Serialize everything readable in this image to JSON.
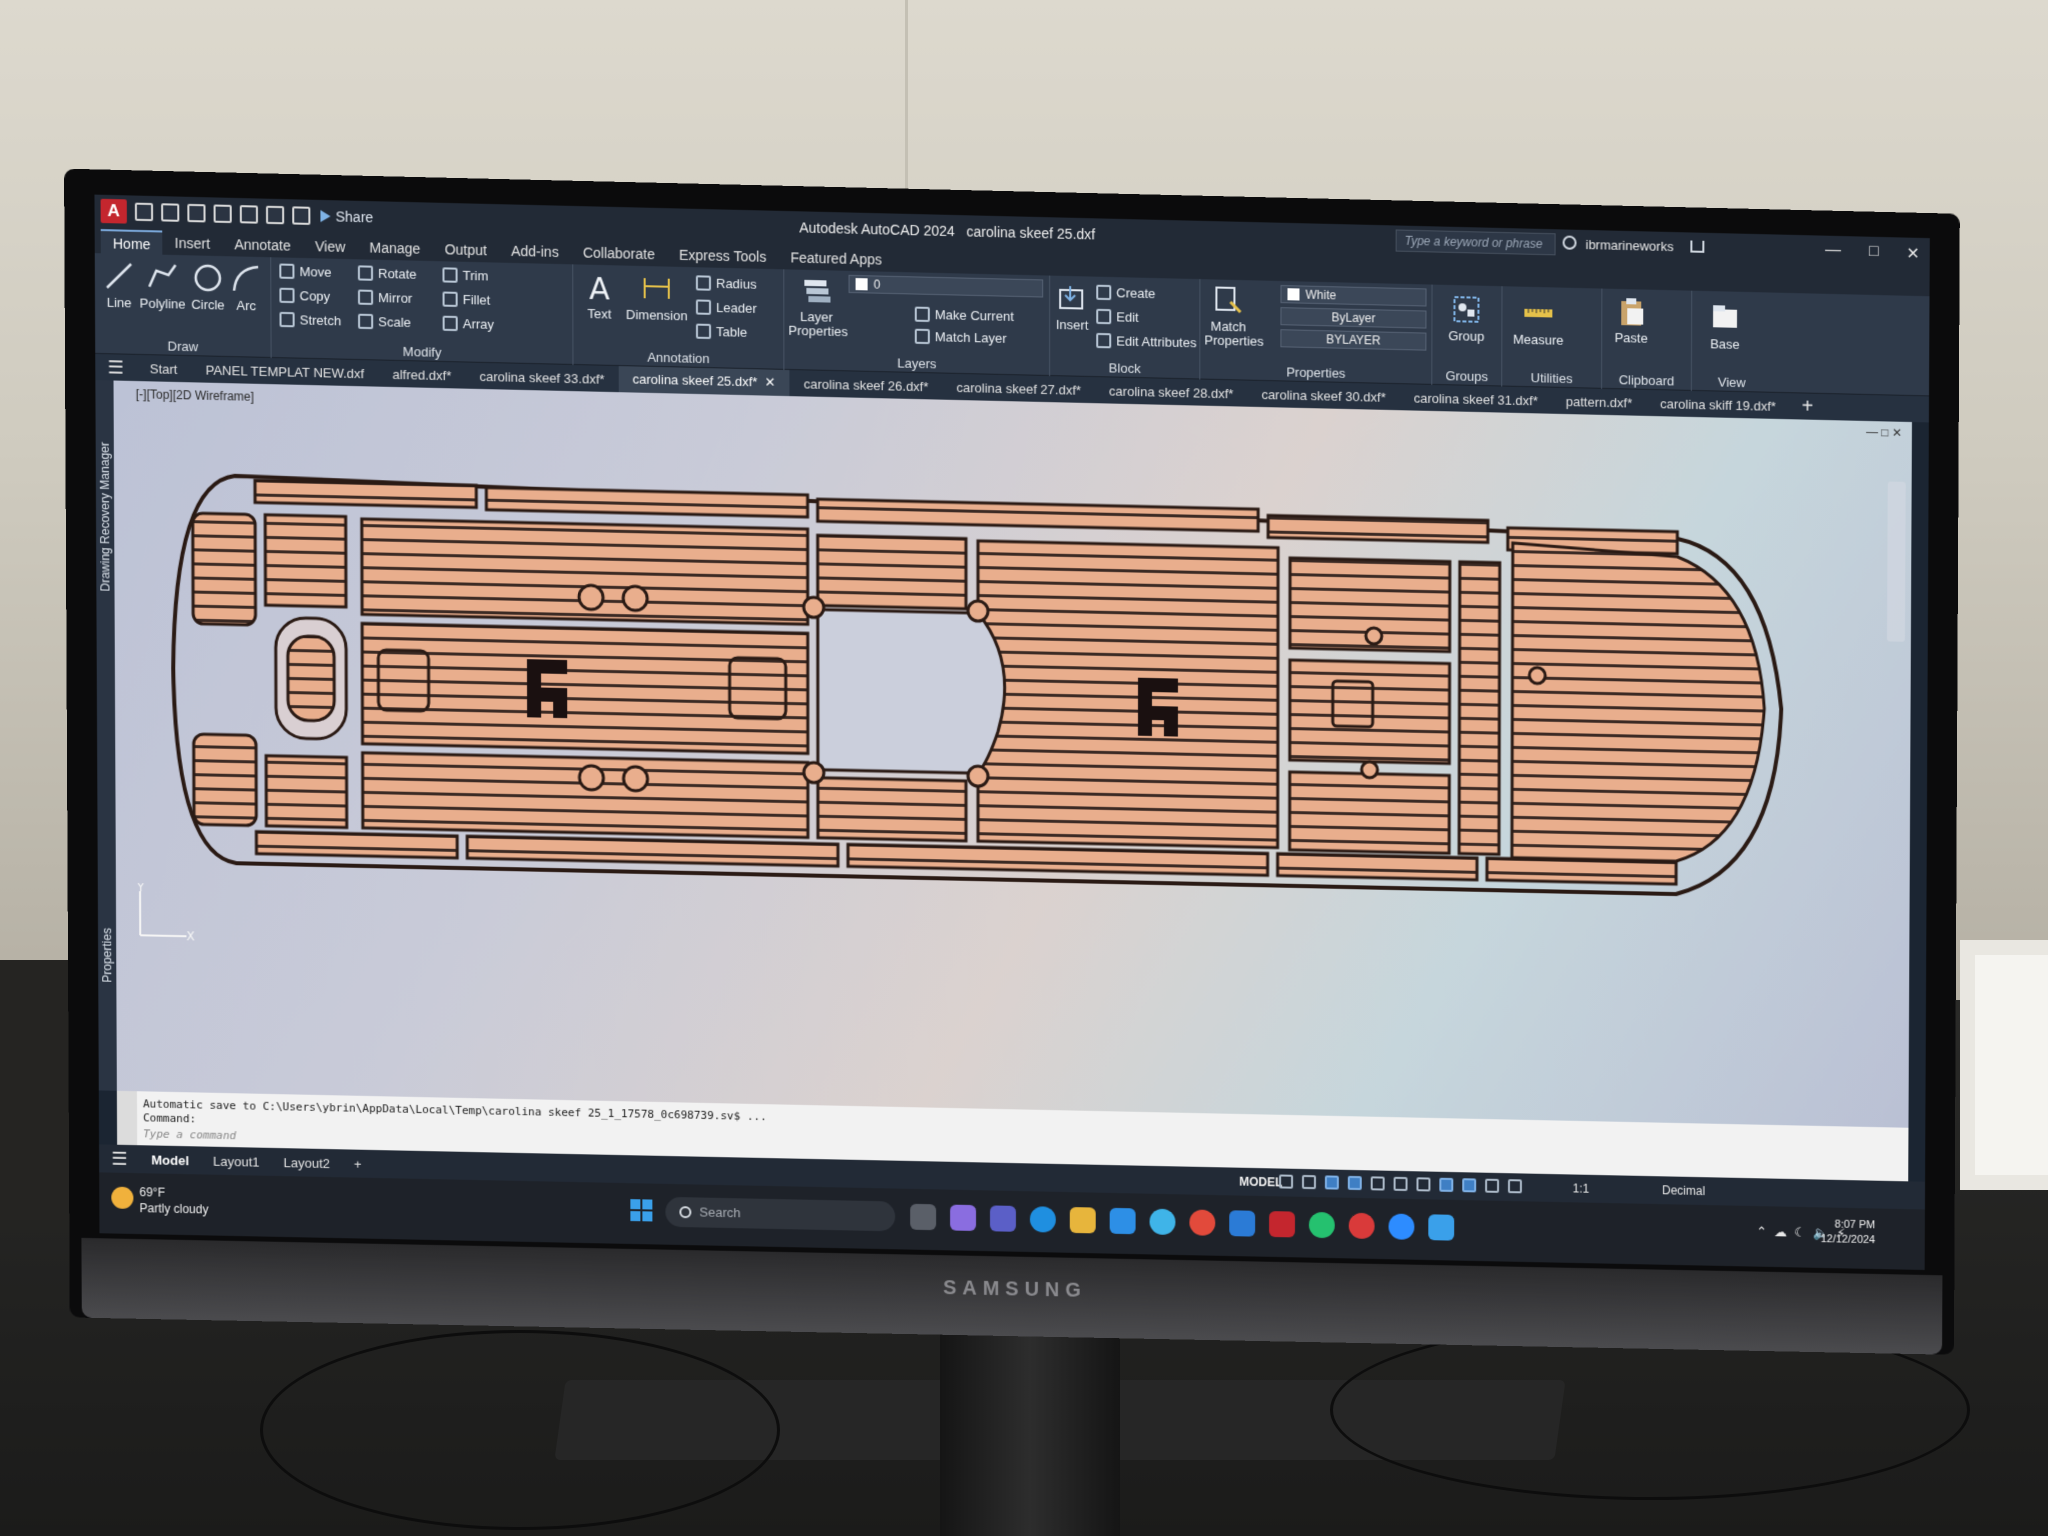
{
  "app": {
    "logo_letter": "A",
    "share": "Share",
    "title": "Autodesk AutoCAD 2024",
    "document": "carolina skeef 25.dxf",
    "search_placeholder": "Type a keyword or phrase",
    "user": "ibrmarineworks"
  },
  "ribbon_tabs": [
    "Home",
    "Insert",
    "Annotate",
    "View",
    "Manage",
    "Output",
    "Add-ins",
    "Collaborate",
    "Express Tools",
    "Featured Apps"
  ],
  "ribbon": {
    "draw": {
      "title": "Draw",
      "line": "Line",
      "polyline": "Polyline",
      "circle": "Circle",
      "arc": "Arc"
    },
    "modify": {
      "title": "Modify",
      "move": "Move",
      "rotate": "Rotate",
      "trim": "Trim",
      "copy": "Copy",
      "mirror": "Mirror",
      "fillet": "Fillet",
      "stretch": "Stretch",
      "scale": "Scale",
      "array": "Array"
    },
    "annotation": {
      "title": "Annotation",
      "text": "Text",
      "dimension": "Dimension",
      "radius": "Radius",
      "leader": "Leader",
      "table": "Table"
    },
    "layers": {
      "title": "Layers",
      "layer_properties": "Layer Properties",
      "current_layer": "0",
      "make_current": "Make Current",
      "match_layer": "Match Layer"
    },
    "block": {
      "title": "Block",
      "insert": "Insert",
      "create": "Create",
      "edit": "Edit",
      "edit_attributes": "Edit Attributes"
    },
    "properties": {
      "title": "Properties",
      "match_properties": "Match Properties",
      "color": "White",
      "linetype": "ByLayer",
      "lineweight": "BYLAYER"
    },
    "groups": {
      "title": "Groups",
      "group": "Group"
    },
    "utilities": {
      "title": "Utilities",
      "measure": "Measure"
    },
    "clipboard": {
      "title": "Clipboard",
      "paste": "Paste"
    },
    "view": {
      "title": "View",
      "base": "Base"
    }
  },
  "file_tabs": [
    "Start",
    "PANEL TEMPLAT NEW.dxf",
    "alfred.dxf*",
    "carolina skeef 33.dxf*",
    "carolina skeef 25.dxf*",
    "carolina skeef 26.dxf*",
    "carolina skeef 27.dxf*",
    "carolina skeef 28.dxf*",
    "carolina skeef 30.dxf*",
    "carolina skeef 31.dxf*",
    "pattern.dxf*",
    "carolina skiff 19.dxf*"
  ],
  "viewport": {
    "label": "[-][Top][2D Wireframe]",
    "side_palettes": [
      "Drawing Recovery Manager",
      "Properties"
    ],
    "ucs_x": "X",
    "ucs_y": "Y",
    "colors": {
      "deck_fill": "#e9ae8d",
      "outline": "#2a1a14",
      "grooves": "#3b2a24"
    }
  },
  "command_line": {
    "history": "Automatic save to C:\\Users\\ybrin\\AppData\\Local\\Temp\\carolina skeef 25_1_17578_0c698739.sv$ ...",
    "prompt": "Command:",
    "placeholder": "Type a command"
  },
  "status": {
    "layout_tabs": [
      "Model",
      "Layout1",
      "Layout2"
    ],
    "mode": "MODEL",
    "scale": "1:1",
    "units": "Decimal"
  },
  "taskbar": {
    "temperature": "69°F",
    "weather": "Partly cloudy",
    "search": "Search",
    "time": "8:07 PM",
    "date": "12/12/2024"
  },
  "monitor_brand": "SAMSUNG"
}
